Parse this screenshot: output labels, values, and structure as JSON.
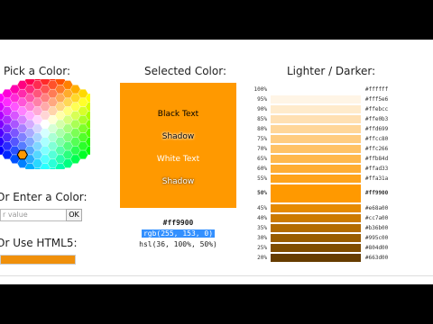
{
  "picker": {
    "title": "Pick a Color:",
    "enter_title": "Or Enter a Color:",
    "input_placeholder": "r value",
    "ok_label": "OK",
    "html5_title": "Or Use HTML5:",
    "html5_color": "#f0900b",
    "selected_hex_cell": "#ff9900"
  },
  "selected": {
    "title": "Selected Color:",
    "color": "#ff9900",
    "black_text": "Black Text",
    "shadow_1": "Shadow",
    "white_text": "White Text",
    "shadow_2": "Shadow",
    "hex": "#ff9900",
    "rgb": "rgb(255, 153, 0)",
    "hsl": "hsl(36, 100%, 50%)"
  },
  "shades": {
    "title": "Lighter / Darker:",
    "rows": [
      {
        "pct": "100%",
        "hex": "#ffffff"
      },
      {
        "pct": "95%",
        "hex": "#fff5e6"
      },
      {
        "pct": "90%",
        "hex": "#ffebcc"
      },
      {
        "pct": "85%",
        "hex": "#ffe0b3"
      },
      {
        "pct": "80%",
        "hex": "#ffd699"
      },
      {
        "pct": "75%",
        "hex": "#ffcc80"
      },
      {
        "pct": "70%",
        "hex": "#ffc266"
      },
      {
        "pct": "65%",
        "hex": "#ffb84d"
      },
      {
        "pct": "60%",
        "hex": "#ffad33"
      },
      {
        "pct": "55%",
        "hex": "#ffa31a"
      },
      {
        "pct": "50%",
        "hex": "#ff9900",
        "selected": true
      },
      {
        "pct": "45%",
        "hex": "#e68a00"
      },
      {
        "pct": "40%",
        "hex": "#cc7a00"
      },
      {
        "pct": "35%",
        "hex": "#b36b00"
      },
      {
        "pct": "30%",
        "hex": "#995c00"
      },
      {
        "pct": "25%",
        "hex": "#804d00"
      },
      {
        "pct": "20%",
        "hex": "#663d00"
      }
    ]
  }
}
